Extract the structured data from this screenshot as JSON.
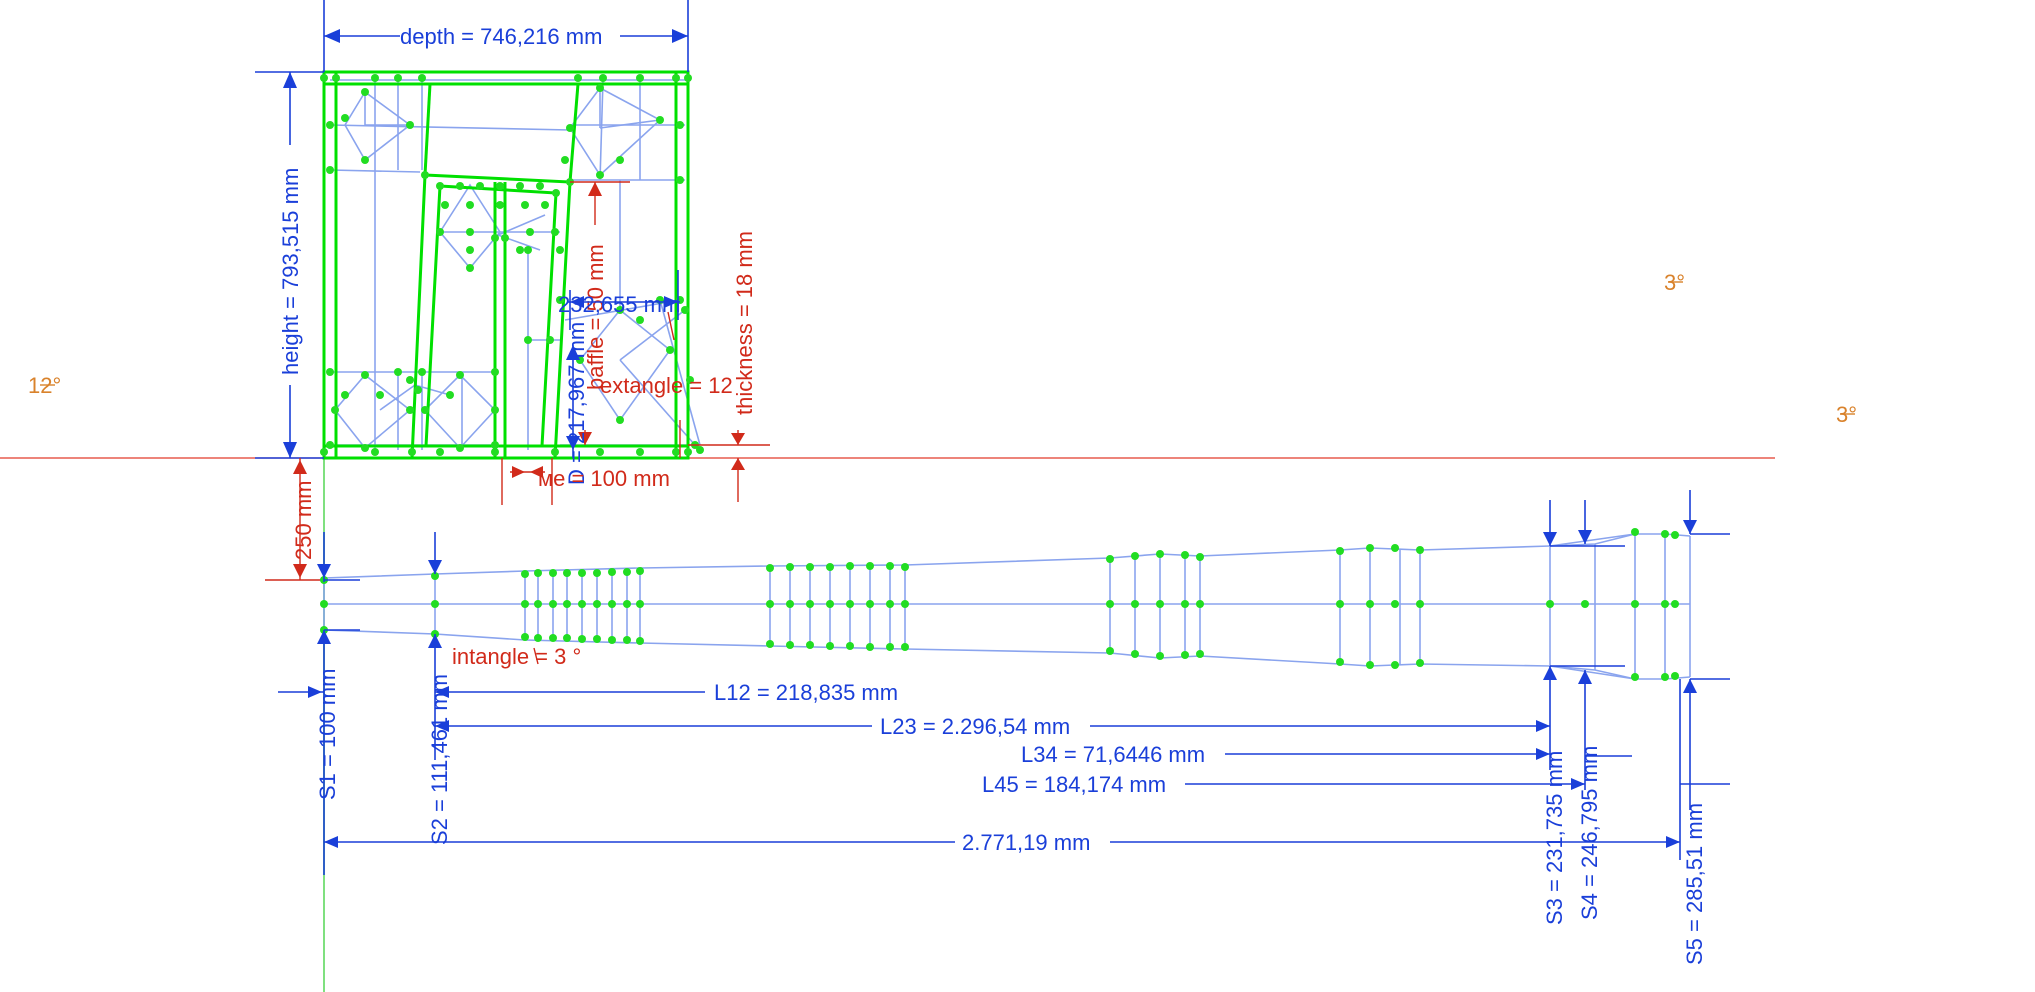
{
  "dimensions": {
    "depth": "depth = 746,216 mm",
    "height": "height = 793,515 mm",
    "thickness": "thickness = 18 mm",
    "extangle": "extangle = 12",
    "baffle": "baffle = 50 mm",
    "D": "D = 217,967 mm",
    "width_top": "232,655 mm",
    "tube": "ме = 100 mm",
    "offset_250": "250 mm",
    "intangle": "intangle = 3 °",
    "S1": "S1 = 100 mm",
    "S2": "S2 = 111,461 mm",
    "S3": "S3 = 231,735 mm",
    "S4": "S4 = 246,795 mm",
    "S5": "S5 = 285,51 mm",
    "L12": "L12 = 218,835 mm",
    "L23": "L23 = 2.296,54 mm",
    "L34": "L34 = 71,6446 mm",
    "L45": "L45 = 184,174 mm",
    "total": "2.771,19 mm"
  },
  "angle_labels": {
    "left": "12°",
    "right_top": "3°",
    "right_mid": "3°"
  },
  "colors": {
    "dimension_blue": "#1a3fd9",
    "constraint_red": "#d12a1a",
    "geometry_green": "#00e000",
    "mesh_blue": "#8aa4ee",
    "angle_orange": "#d9822b"
  }
}
